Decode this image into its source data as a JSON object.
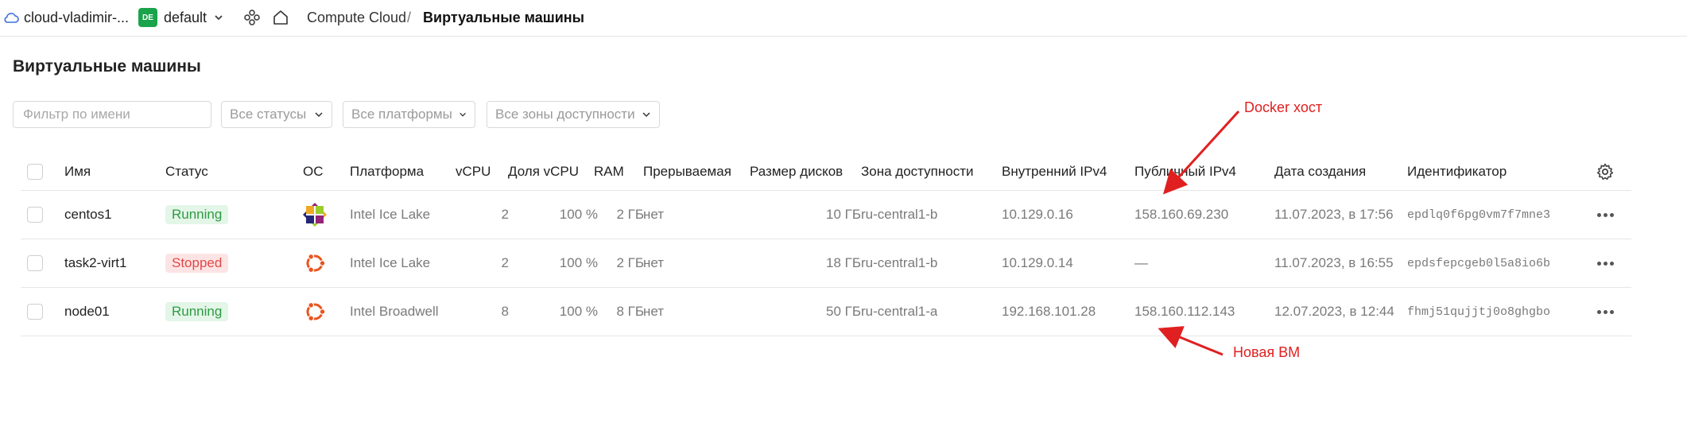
{
  "topbar": {
    "cloud_name": "cloud-vladimir-...",
    "folder_badge": "DE",
    "folder_name": "default",
    "breadcrumb": [
      "Compute Cloud",
      "/",
      "Виртуальные машины"
    ]
  },
  "page_title": "Виртуальные машины",
  "filters": {
    "name_placeholder": "Фильтр по имени",
    "status": "Все статусы",
    "platform": "Все платформы",
    "zone": "Все зоны доступности"
  },
  "table": {
    "columns": [
      "Имя",
      "Статус",
      "ОС",
      "Платформа",
      "vCPU",
      "Доля vCPU",
      "RAM",
      "Прерываемая",
      "Размер дисков",
      "Зона доступности",
      "Внутренний IPv4",
      "Публичный IPv4",
      "Дата создания",
      "Идентификатор"
    ],
    "rows": [
      {
        "name": "centos1",
        "status": "Running",
        "status_type": "running",
        "os_icon": "centos-icon",
        "platform": "Intel Ice Lake",
        "vcpu": "2",
        "vcpu_share": "100 %",
        "ram": "2 ГБ",
        "preemptible": "нет",
        "disk": "10 ГБ",
        "zone": "ru-central1-b",
        "internal_ip": "10.129.0.16",
        "public_ip": "158.160.69.230",
        "created": "11.07.2023, в 17:56",
        "id": "epdlq0f6pg0vm7f7mne3"
      },
      {
        "name": "task2-virt1",
        "status": "Stopped",
        "status_type": "stopped",
        "os_icon": "ubuntu-icon",
        "platform": "Intel Ice Lake",
        "vcpu": "2",
        "vcpu_share": "100 %",
        "ram": "2 ГБ",
        "preemptible": "нет",
        "disk": "18 ГБ",
        "zone": "ru-central1-b",
        "internal_ip": "10.129.0.14",
        "public_ip": "—",
        "created": "11.07.2023, в 16:55",
        "id": "epdsfepcgeb0l5a8io6b"
      },
      {
        "name": "node01",
        "status": "Running",
        "status_type": "running",
        "os_icon": "ubuntu-icon",
        "platform": "Intel Broadwell",
        "vcpu": "8",
        "vcpu_share": "100 %",
        "ram": "8 ГБ",
        "preemptible": "нет",
        "disk": "50 ГБ",
        "zone": "ru-central1-a",
        "internal_ip": "192.168.101.28",
        "public_ip": "158.160.112.143",
        "created": "12.07.2023, в 12:44",
        "id": "fhmj51qujjtj0o8ghgbo"
      }
    ]
  },
  "annotations": {
    "docker_host": "Docker хост",
    "new_vm": "Новая ВМ",
    "color": "#e02020"
  },
  "colors": {
    "running_bg": "#e3f6e7",
    "running_fg": "#2f9a44",
    "stopped_bg": "#fde4e4",
    "stopped_fg": "#e04848",
    "folder_badge": "#1aa34a"
  }
}
